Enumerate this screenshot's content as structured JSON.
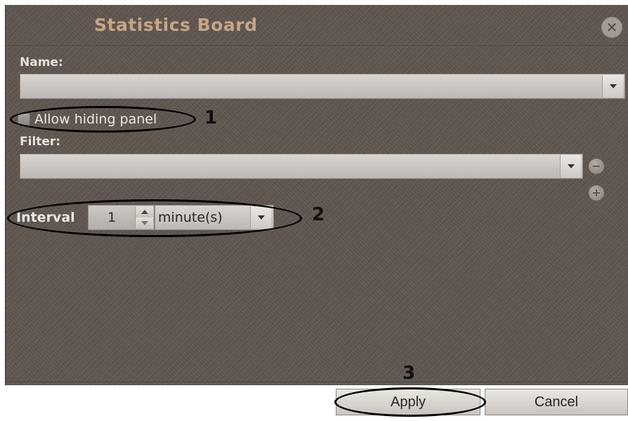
{
  "dialog": {
    "title": "Statistics Board",
    "close_icon": "close-icon"
  },
  "name_field": {
    "label": "Name:",
    "value": ""
  },
  "allow_hiding": {
    "label": "Allow hiding panel",
    "checked": false
  },
  "filter_field": {
    "label": "Filter:",
    "value": "",
    "remove_icon": "minus-icon",
    "add_icon": "plus-icon"
  },
  "interval": {
    "label": "Interval",
    "value": "1",
    "unit": "minute(s)"
  },
  "buttons": {
    "apply": "Apply",
    "cancel": "Cancel"
  },
  "annotations": {
    "one": "1",
    "two": "2",
    "three": "3"
  }
}
